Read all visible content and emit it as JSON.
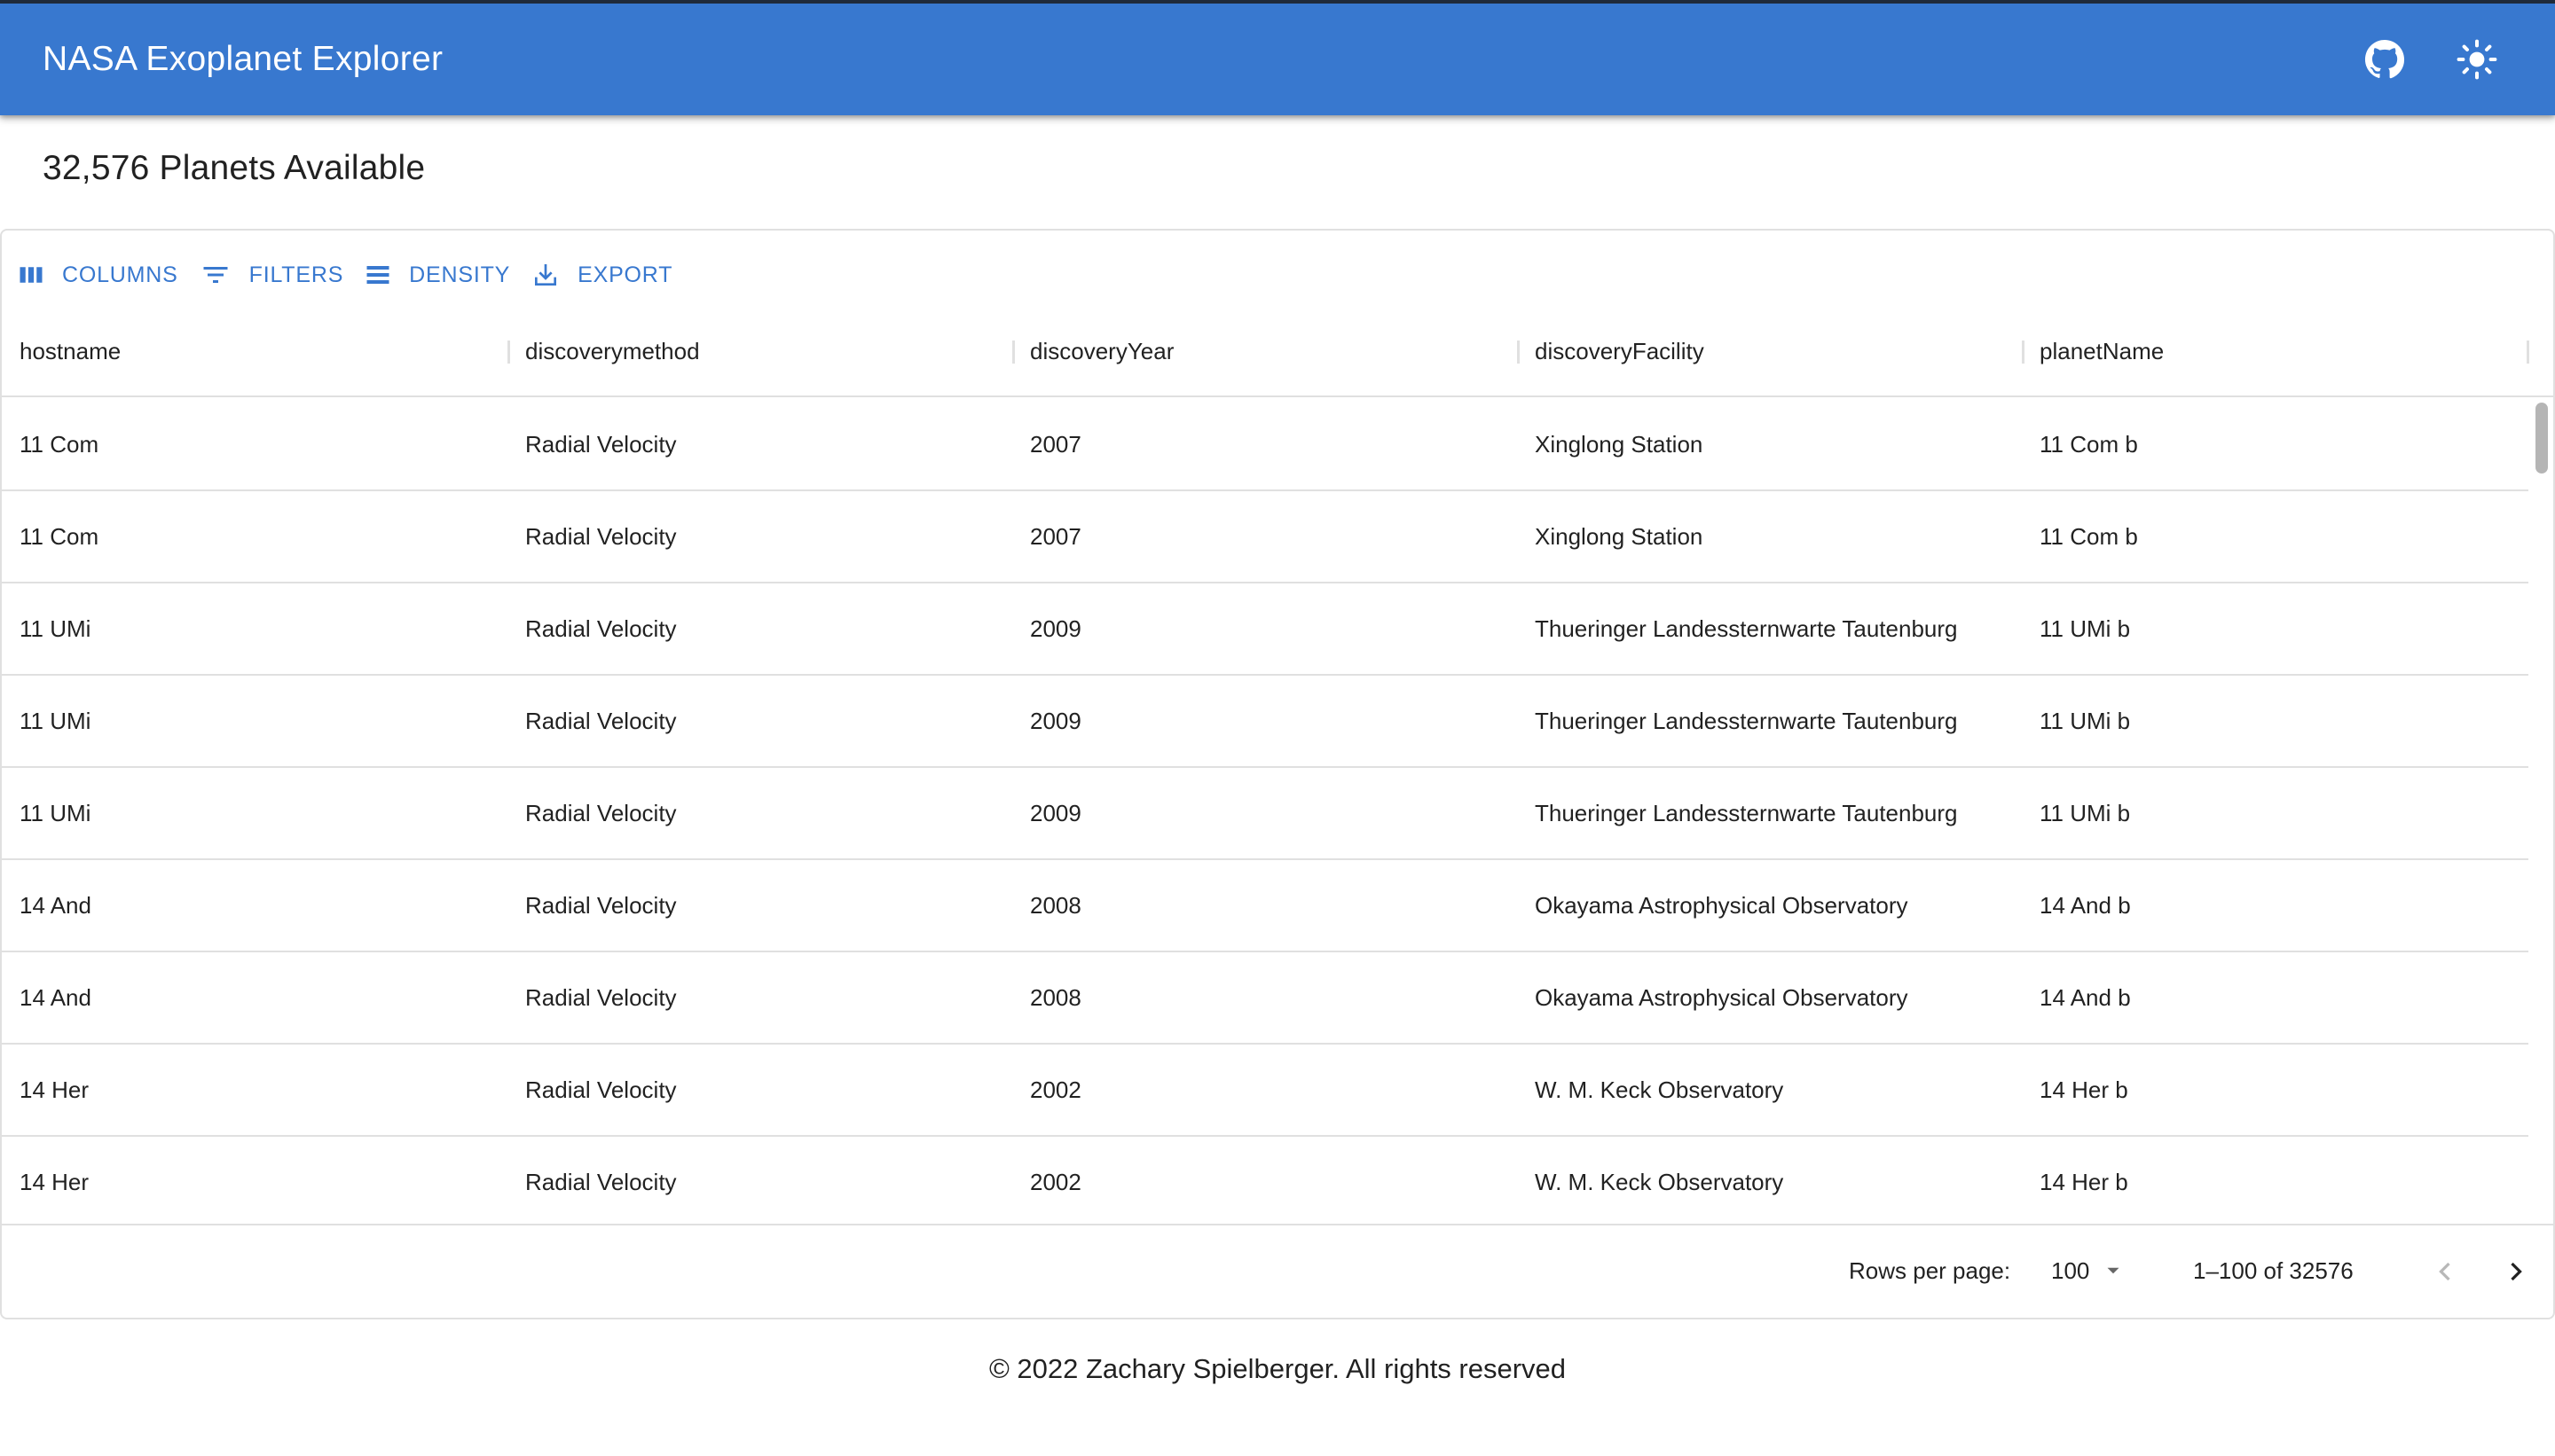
{
  "app": {
    "title": "NASA Exoplanet Explorer"
  },
  "page": {
    "heading": "32,576 Planets Available"
  },
  "toolbar": {
    "columns_label": "Columns",
    "filters_label": "Filters",
    "density_label": "Density",
    "export_label": "Export"
  },
  "table": {
    "columns": [
      "hostname",
      "discoverymethod",
      "discoveryYear",
      "discoveryFacility",
      "planetName"
    ],
    "rows": [
      [
        "11 Com",
        "Radial Velocity",
        "2007",
        "Xinglong Station",
        "11 Com b"
      ],
      [
        "11 Com",
        "Radial Velocity",
        "2007",
        "Xinglong Station",
        "11 Com b"
      ],
      [
        "11 UMi",
        "Radial Velocity",
        "2009",
        "Thueringer Landessternwarte Tautenburg",
        "11 UMi b"
      ],
      [
        "11 UMi",
        "Radial Velocity",
        "2009",
        "Thueringer Landessternwarte Tautenburg",
        "11 UMi b"
      ],
      [
        "11 UMi",
        "Radial Velocity",
        "2009",
        "Thueringer Landessternwarte Tautenburg",
        "11 UMi b"
      ],
      [
        "14 And",
        "Radial Velocity",
        "2008",
        "Okayama Astrophysical Observatory",
        "14 And b"
      ],
      [
        "14 And",
        "Radial Velocity",
        "2008",
        "Okayama Astrophysical Observatory",
        "14 And b"
      ],
      [
        "14 Her",
        "Radial Velocity",
        "2002",
        "W. M. Keck Observatory",
        "14 Her b"
      ],
      [
        "14 Her",
        "Radial Velocity",
        "2002",
        "W. M. Keck Observatory",
        "14 Her b"
      ]
    ]
  },
  "pagination": {
    "rows_per_page_label": "Rows per page:",
    "rows_per_page_value": "100",
    "range_text": "1–100 of 32576"
  },
  "footer": {
    "copyright": "© 2022 Zachary Spielberger. All rights reserved"
  },
  "colors": {
    "primary": "#3878cf",
    "divider": "#e0e0e0"
  },
  "icons": {
    "appbar": [
      "github-icon",
      "light-mode-icon"
    ],
    "toolbar": [
      "view-column-icon",
      "filter-list-icon",
      "density-icon",
      "download-icon"
    ],
    "pagination": [
      "arrow-drop-down-icon",
      "chevron-left-icon",
      "chevron-right-icon"
    ]
  }
}
